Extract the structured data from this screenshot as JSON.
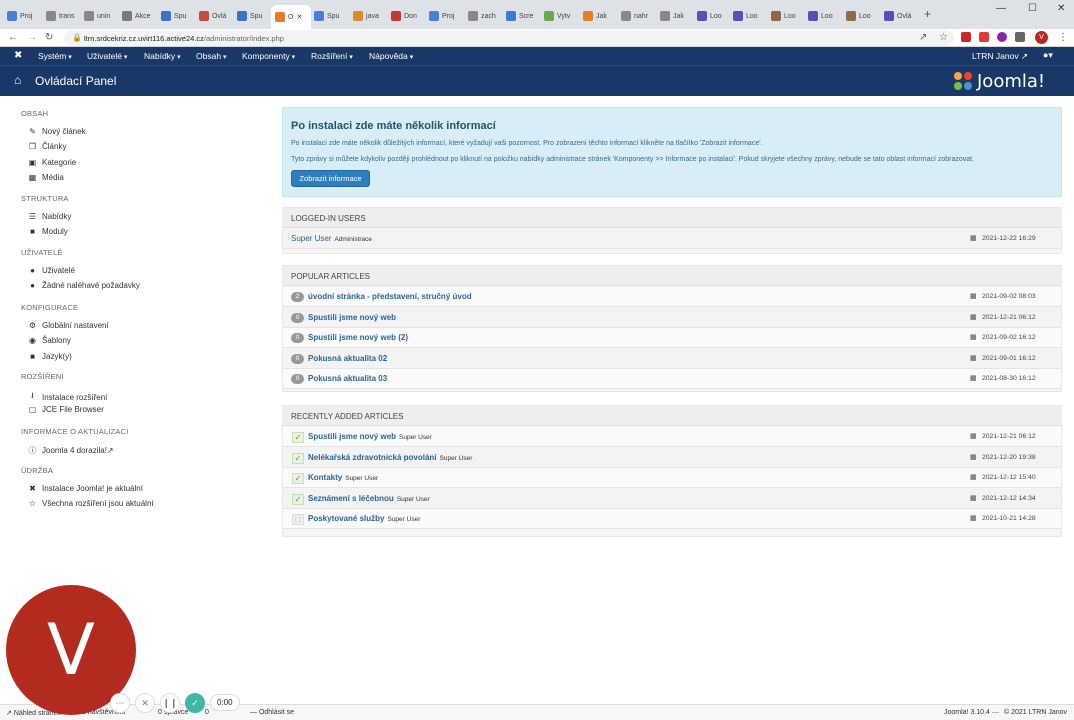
{
  "browser": {
    "tabs": [
      {
        "label": "Proj",
        "color": "#4a7fd6"
      },
      {
        "label": "trans",
        "color": "#888888"
      },
      {
        "label": "unin",
        "color": "#888888"
      },
      {
        "label": "Akce",
        "color": "#7a7a7a"
      },
      {
        "label": "Spu",
        "color": "#3d73c4"
      },
      {
        "label": "Ovlá",
        "color": "#c44d3d"
      },
      {
        "label": "Spu",
        "color": "#3d73c4"
      },
      {
        "label": "O",
        "color": "#e87a2e"
      },
      {
        "label": "Spu",
        "color": "#4a7fd6"
      },
      {
        "label": "java",
        "color": "#d98c2b"
      },
      {
        "label": "Don",
        "color": "#c13a2b"
      },
      {
        "label": "Proj",
        "color": "#4a7fd6"
      },
      {
        "label": "zach",
        "color": "#888888"
      },
      {
        "label": "Scre",
        "color": "#3a7bd5"
      },
      {
        "label": "Vytv",
        "color": "#6aa84f"
      },
      {
        "label": "Jak",
        "color": "#e67e22"
      },
      {
        "label": "nahr",
        "color": "#888888"
      },
      {
        "label": "Jak",
        "color": "#888888"
      },
      {
        "label": "Loo",
        "color": "#5b4fb5"
      },
      {
        "label": "Loo",
        "color": "#5b4fb5"
      },
      {
        "label": "Loo",
        "color": "#8b6b4a"
      },
      {
        "label": "Loo",
        "color": "#5b4fb5"
      },
      {
        "label": "Loo",
        "color": "#8b6b4a"
      },
      {
        "label": "Ovlá",
        "color": "#5b4fb5"
      }
    ],
    "url_host": "ltrn.srdcekriz.cz.uvirt116.active24.cz",
    "url_path": "/administrator/index.php",
    "profile_initial": "V"
  },
  "joomla_nav": {
    "menus": [
      "Systém",
      "Uživatelé",
      "Nabídky",
      "Obsah",
      "Komponenty",
      "Rozšíření",
      "Nápověda"
    ],
    "site_name": "LTRN Janov"
  },
  "header": {
    "title": "Ovládací Panel",
    "logo_text": "Joomla!"
  },
  "sidebar": {
    "sections": [
      {
        "title": "OBSAH",
        "items": [
          {
            "label": "Nový článek",
            "icon": "pencil-icon"
          },
          {
            "label": "Články",
            "icon": "copy-icon"
          },
          {
            "label": "Kategorie",
            "icon": "folder-icon"
          },
          {
            "label": "Média",
            "icon": "image-icon"
          }
        ]
      },
      {
        "title": "STRUKTURA",
        "items": [
          {
            "label": "Nabídky",
            "icon": "list-icon"
          },
          {
            "label": "Moduly",
            "icon": "cube-icon"
          }
        ]
      },
      {
        "title": "UŽIVATELÉ",
        "items": [
          {
            "label": "Uživatelé",
            "icon": "user-icon"
          },
          {
            "label": "Žádné naléhavé požadavky",
            "icon": "users-icon"
          }
        ]
      },
      {
        "title": "KONFIGURACE",
        "items": [
          {
            "label": "Globální nastavení",
            "icon": "cog-icon"
          },
          {
            "label": "Šablony",
            "icon": "eye-icon"
          },
          {
            "label": "Jazyk(y)",
            "icon": "comments-icon"
          }
        ]
      },
      {
        "title": "ROZŠÍŘENÍ",
        "items": [
          {
            "label": "Instalace rozšíření",
            "icon": "download-icon"
          },
          {
            "label": "JCE File Browser",
            "icon": "folder-open-icon"
          }
        ]
      },
      {
        "title": "INFORMACE O AKTUALIZACI",
        "items": [
          {
            "label": "Joomla 4 dorazila!",
            "icon": "info-icon"
          }
        ]
      },
      {
        "title": "ÚDRŽBA",
        "items": [
          {
            "label": "Instalace Joomla! je aktuální",
            "icon": "joomla-icon"
          },
          {
            "label": "Všechna rozšíření jsou aktuální",
            "icon": "star-icon"
          }
        ]
      }
    ]
  },
  "info": {
    "title": "Po instalaci zde máte několik informací",
    "line1": "Po instalaci zde máte několik důležitých informací, které vyžadují vaši pozornost. Pro zobrazení těchto informací klikněte na tlačítko 'Zobrazit informace'.",
    "line2": "Tyto zprávy si můžete kdykoliv později prohlédnout po kliknutí na položku nabídky administrace stránek 'Komponenty >> Informace po instalaci'. Pokud skryjete všechny zprávy, nebude se tato oblast informací zobrazovat.",
    "button": "Zobrazit informace"
  },
  "logged_in": {
    "title": "LOGGED-IN USERS",
    "rows": [
      {
        "name": "Super User",
        "role": "Administrace",
        "date": "2021-12-22 16:29"
      }
    ]
  },
  "popular": {
    "title": "POPULAR ARTICLES",
    "rows": [
      {
        "hits": "2",
        "title": "úvodní stránka - představení, stručný úvod",
        "date": "2021-09-02 08:03"
      },
      {
        "hits": "0",
        "title": "Spustili jsme nový web",
        "date": "2021-12-21 06:12"
      },
      {
        "hits": "0",
        "title": "Spustili jsme nový web (2)",
        "date": "2021-09-02 16:12"
      },
      {
        "hits": "0",
        "title": "Pokusná aktualita 02",
        "date": "2021-09-01 16:12"
      },
      {
        "hits": "0",
        "title": "Pokusná aktualita 03",
        "date": "2021-08-30 16:12"
      }
    ]
  },
  "recent": {
    "title": "RECENTLY ADDED ARTICLES",
    "rows": [
      {
        "published": true,
        "title": "Spustili jsme nový web",
        "author": "Super User",
        "date": "2021-12-21 06:12"
      },
      {
        "published": true,
        "title": "Nelékařská zdravotnická povolání",
        "author": "Super User",
        "date": "2021-12-20 19:38"
      },
      {
        "published": true,
        "title": "Kontakty",
        "author": "Super User",
        "date": "2021-12-12 15:40"
      },
      {
        "published": true,
        "title": "Seznámení s léčebnou",
        "author": "Super User",
        "date": "2021-12-12 14:34"
      },
      {
        "published": false,
        "title": "Poskytované služby",
        "author": "Super User",
        "date": "2021-10-21 14:28"
      }
    ]
  },
  "footer": {
    "items": [
      "Náhled stránek",
      "0 návštěvníků",
      "0 správce",
      "0",
      "Odhlásit se"
    ],
    "version": "Joomla! 3.10.4",
    "copyright": "© 2021 LTRN Janov"
  },
  "recorder": {
    "avatar_letter": "V",
    "time": "0:00"
  }
}
